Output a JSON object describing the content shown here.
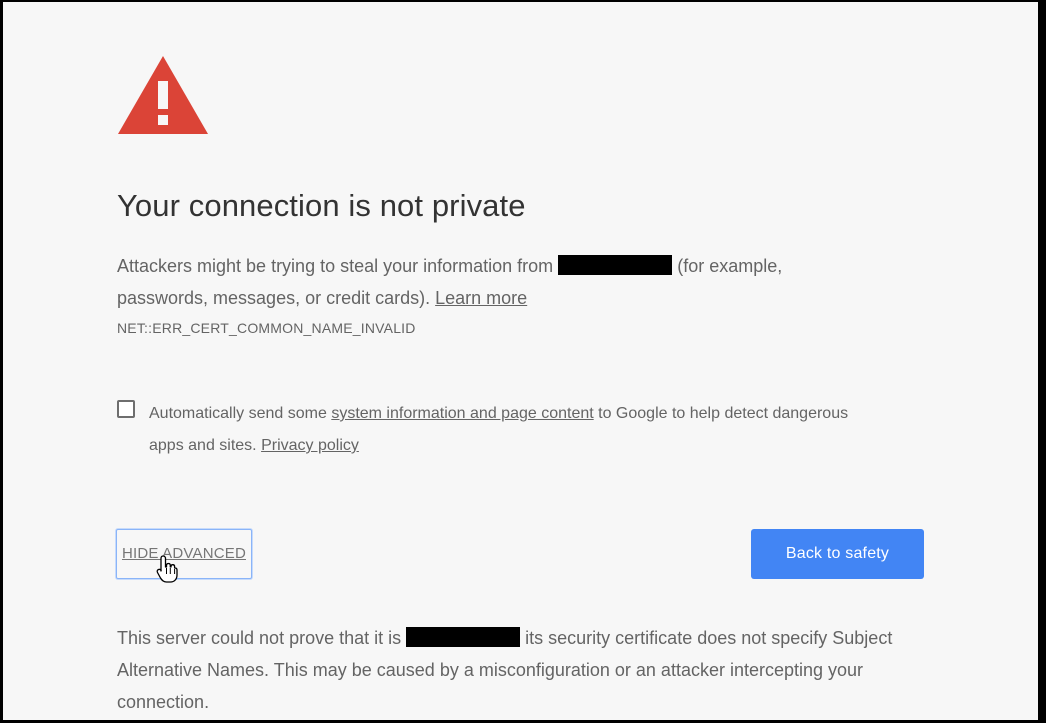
{
  "page": {
    "icon": "warning-triangle-icon",
    "heading": "Your connection is not private",
    "intro_before": "Attackers might be trying to steal your information from",
    "intro_after": "(for example, passwords, messages, or credit cards).",
    "learn_more": "Learn more",
    "error_code": "NET::ERR_CERT_COMMON_NAME_INVALID"
  },
  "report": {
    "text_before": "Automatically send some",
    "link": "system information and page content",
    "text_after": "to Google to help detect dangerous apps and sites.",
    "privacy_link": "Privacy policy",
    "checked": false
  },
  "buttons": {
    "hide_advanced": "HIDE ADVANCED",
    "back_to_safety": "Back to safety"
  },
  "details": {
    "before": "This server could not prove that it is",
    "after": "its security certificate does not specify Subject Alternative Names. This may be caused by a misconfiguration or an attacker intercepting your connection."
  },
  "colors": {
    "accent": "#4285f4",
    "warning": "#db4437",
    "text": "#646464",
    "background": "#f7f7f7"
  }
}
